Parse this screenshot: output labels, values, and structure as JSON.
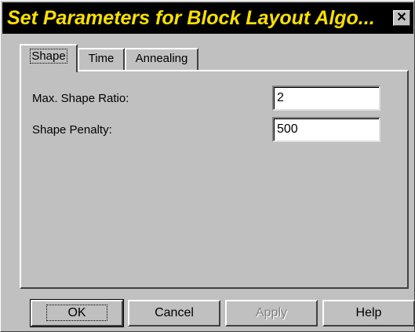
{
  "window": {
    "title": "Set Parameters for Block Layout Algo...",
    "close_glyph": "✕"
  },
  "tabs": [
    {
      "label": "Shape",
      "active": true
    },
    {
      "label": "Time",
      "active": false
    },
    {
      "label": "Annealing",
      "active": false
    }
  ],
  "shape_panel": {
    "max_shape_ratio": {
      "label": "Max. Shape Ratio:",
      "value": "2"
    },
    "shape_penalty": {
      "label": "Shape Penalty:",
      "value": "500"
    }
  },
  "buttons": {
    "ok": "OK",
    "cancel": "Cancel",
    "apply": "Apply",
    "help": "Help"
  },
  "icons": {
    "close": "close-icon"
  },
  "colors": {
    "title_bg": "#000000",
    "title_text": "#f8e000",
    "face": "#c0c0c0"
  }
}
